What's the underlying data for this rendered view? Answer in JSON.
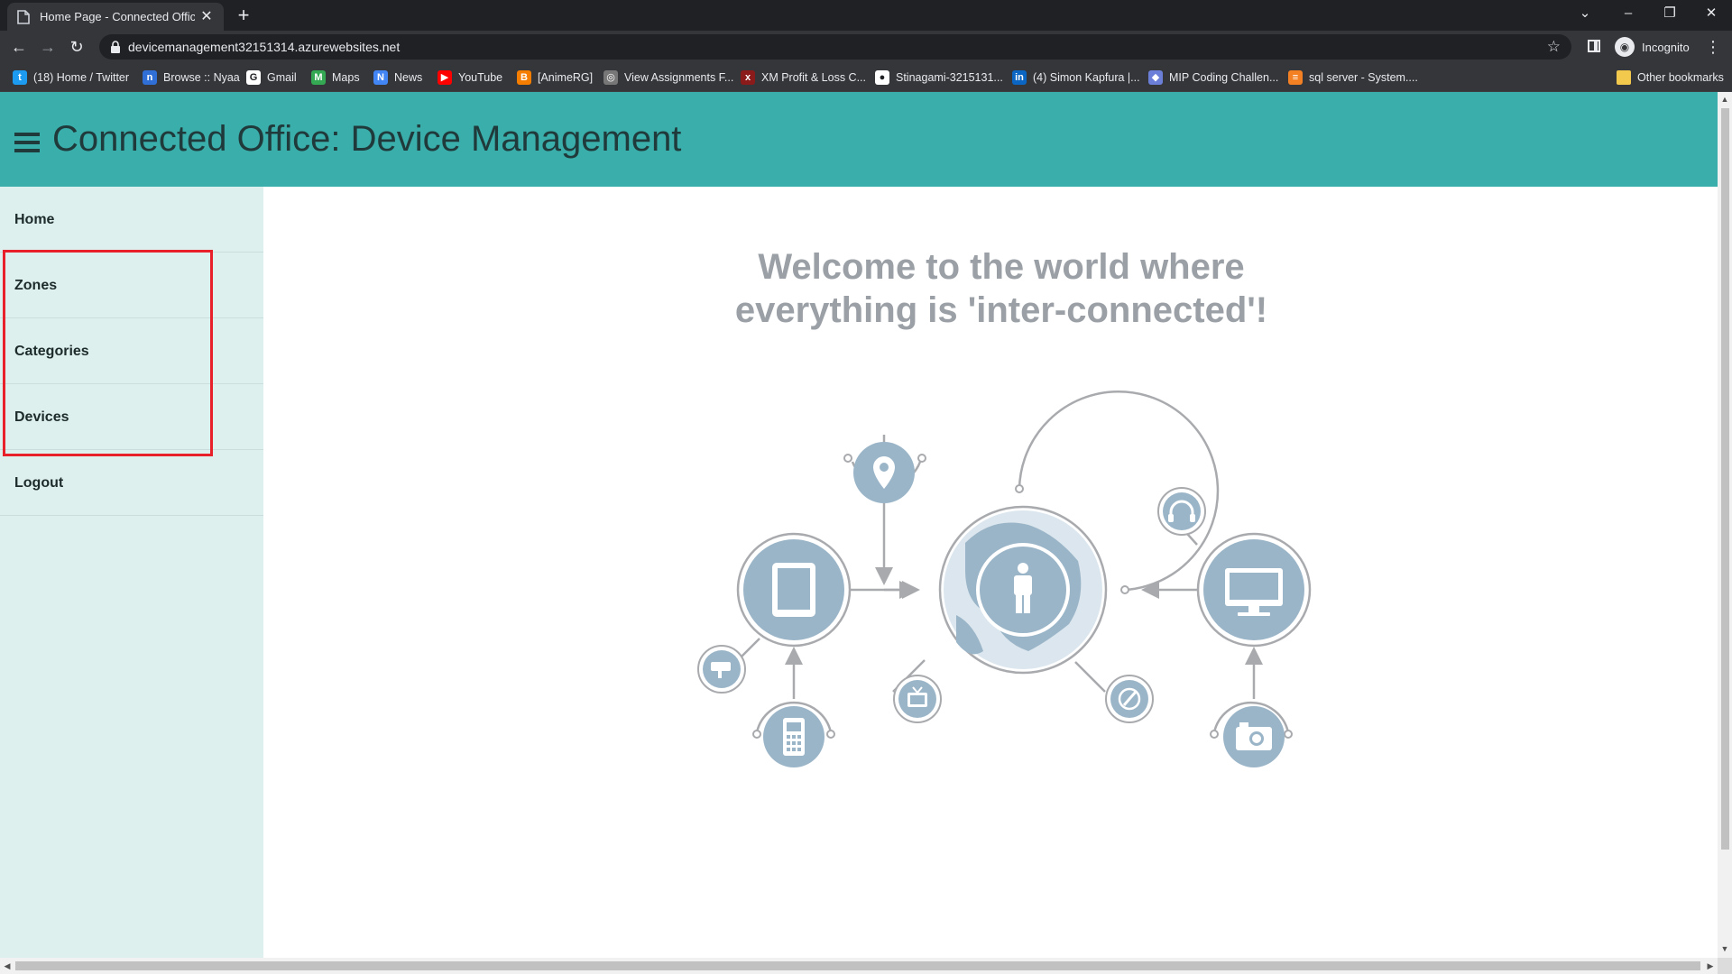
{
  "browser": {
    "tab": {
      "title": "Home Page - Connected Office: D",
      "close": "✕"
    },
    "new_tab": "+",
    "window_controls": {
      "tabs_menu": "⌄",
      "minimize": "–",
      "restore": "❐",
      "close": "✕"
    },
    "nav": {
      "back": "←",
      "forward": "→",
      "reload": "↻"
    },
    "url": "devicemanagement32151314.azurewebsites.net",
    "star": "☆",
    "profile_label": "Incognito",
    "menu": "⋮",
    "bookmarks": [
      {
        "label": "(18) Home / Twitter",
        "icon": "twitter-icon",
        "color": "#1d9bf0",
        "glyph": "t"
      },
      {
        "label": "Browse :: Nyaa",
        "icon": "nyaa-icon",
        "color": "#2f6fd6",
        "glyph": "n"
      },
      {
        "label": "Gmail",
        "icon": "google-icon",
        "color": "#ffffff",
        "glyph": "G"
      },
      {
        "label": "Maps",
        "icon": "maps-icon",
        "color": "#34a853",
        "glyph": "M"
      },
      {
        "label": "News",
        "icon": "news-icon",
        "color": "#4285f4",
        "glyph": "N"
      },
      {
        "label": "YouTube",
        "icon": "youtube-icon",
        "color": "#ff0000",
        "glyph": "▶"
      },
      {
        "label": "[AnimeRG]",
        "icon": "blogger-icon",
        "color": "#f57d00",
        "glyph": "B"
      },
      {
        "label": "View Assignments F...",
        "icon": "globe-icon",
        "color": "#777777",
        "glyph": "◎"
      },
      {
        "label": "XM Profit & Loss C...",
        "icon": "xm-icon",
        "color": "#8b1a1a",
        "glyph": "x"
      },
      {
        "label": "Stinagami-3215131...",
        "icon": "github-icon",
        "color": "#ffffff",
        "glyph": "●"
      },
      {
        "label": "(4) Simon Kapfura |...",
        "icon": "linkedin-icon",
        "color": "#0a66c2",
        "glyph": "in"
      },
      {
        "label": "MIP Coding Challen...",
        "icon": "mip-icon",
        "color": "#6b7fd8",
        "glyph": "◆"
      },
      {
        "label": "sql server - System....",
        "icon": "stackoverflow-icon",
        "color": "#f48024",
        "glyph": "≡"
      }
    ],
    "other_bookmarks": "Other bookmarks"
  },
  "header": {
    "title": "Connected Office: Device Management"
  },
  "sidebar": {
    "items": [
      {
        "label": "Home"
      },
      {
        "label": "Zones"
      },
      {
        "label": "Categories"
      },
      {
        "label": "Devices"
      },
      {
        "label": "Logout"
      }
    ]
  },
  "main": {
    "welcome_line1": "Welcome to the world where",
    "welcome_line2": "everything is 'inter-connected'!",
    "illustration_color": "#9bb5c8",
    "line_color": "#a8aaad"
  },
  "colors": {
    "header_bg": "#3aaeaa",
    "sidebar_bg": "#ddf0ee",
    "highlight": "#e8202a"
  }
}
